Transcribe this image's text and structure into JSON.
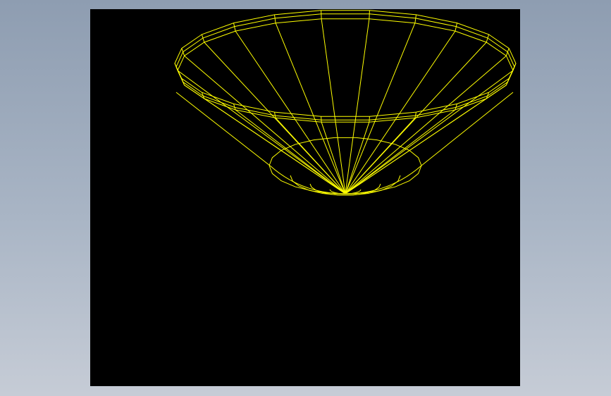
{
  "model_view": {
    "background_color": "#000000",
    "wireframe_color": "#ffff00",
    "render_mode": "wireframe",
    "model": "bowl"
  }
}
